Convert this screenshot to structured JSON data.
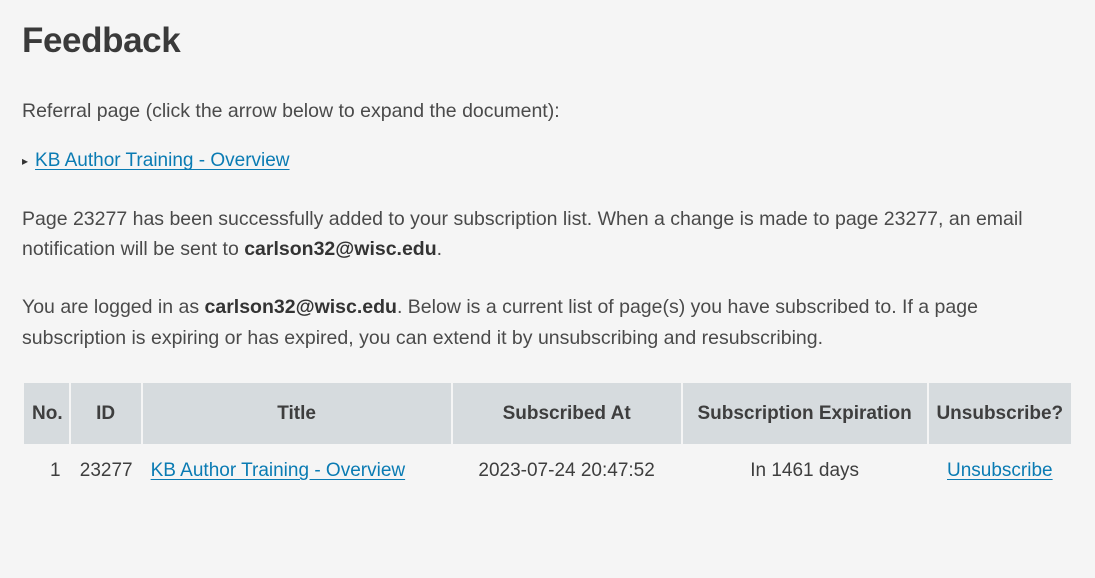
{
  "heading": "Feedback",
  "referral_intro": "Referral page (click the arrow below to expand the document):",
  "referral_link_text": "KB Author Training - Overview",
  "confirm_msg_1": "Page 23277 has been successfully added to your subscription list. When a change is made to page 23277, an email notification will be sent to ",
  "confirm_email": "carlson32@wisc.edu",
  "confirm_msg_2": ".",
  "logged_in_1": "You are logged in as ",
  "logged_in_email": "carlson32@wisc.edu",
  "logged_in_2": ". Below is a current list of page(s) you have subscribed to. If a page subscription is expiring or has expired, you can extend it by unsubscribing and resubscribing.",
  "table": {
    "headers": {
      "no": "No.",
      "id": "ID",
      "title": "Title",
      "subscribed_at": "Subscribed At",
      "expiration": "Subscription Expiration",
      "unsubscribe": "Unsubscribe?"
    },
    "rows": [
      {
        "no": "1",
        "id": "23277",
        "title": "KB Author Training - Overview",
        "subscribed_at": "2023-07-24 20:47:52",
        "expiration": "In 1461 days",
        "unsubscribe_label": "Unsubscribe"
      }
    ]
  }
}
